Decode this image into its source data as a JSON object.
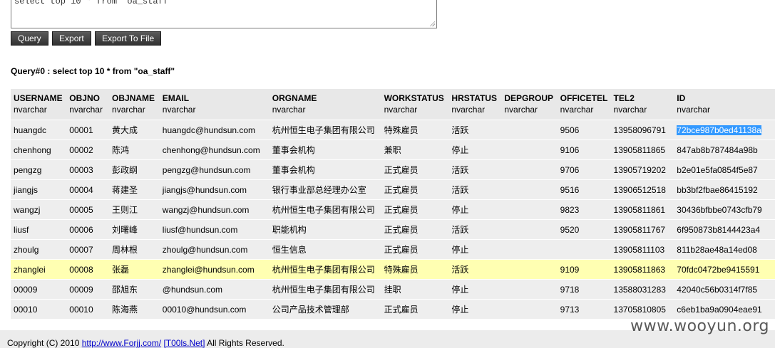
{
  "editor": {
    "sql_text": "select top 10 * from \"oa_staff\""
  },
  "toolbar": {
    "query_label": "Query",
    "export_label": "Export",
    "export_file_label": "Export To File"
  },
  "result": {
    "title": "Query#0 : select top 10 * from \"oa_staff\"",
    "columns": [
      {
        "name": "USERNAME",
        "type": "nvarchar"
      },
      {
        "name": "OBJNO",
        "type": "nvarchar"
      },
      {
        "name": "OBJNAME",
        "type": "nvarchar"
      },
      {
        "name": "EMAIL",
        "type": "nvarchar"
      },
      {
        "name": "ORGNAME",
        "type": "nvarchar"
      },
      {
        "name": "WORKSTATUS",
        "type": "nvarchar"
      },
      {
        "name": "HRSTATUS",
        "type": "nvarchar"
      },
      {
        "name": "DEPGROUP",
        "type": "nvarchar"
      },
      {
        "name": "OFFICETEL",
        "type": "nvarchar"
      },
      {
        "name": "TEL2",
        "type": "nvarchar"
      },
      {
        "name": "ID",
        "type": "nvarchar"
      }
    ],
    "rows": [
      [
        "huangdc",
        "00001",
        "黄大成",
        "huangdc@hundsun.com",
        "杭州恒生电子集团有限公司",
        "特殊雇员",
        "活跃",
        "",
        "9506",
        "13958096791",
        "72bce987b0ed41138a"
      ],
      [
        "chenhong",
        "00002",
        "陈鸿",
        "chenhong@hundsun.com",
        "董事会机构",
        "兼职",
        "停止",
        "",
        "9106",
        "13905811865",
        "847ab8b787484a98b"
      ],
      [
        "pengzg",
        "00003",
        "彭政纲",
        "pengzg@hundsun.com",
        "董事会机构",
        "正式雇员",
        "活跃",
        "",
        "9706",
        "13905719202",
        "b2e01e5fa0854f5e87"
      ],
      [
        "jiangjs",
        "00004",
        "蒋建圣",
        "jiangjs@hundsun.com",
        "银行事业部总经理办公室",
        "正式雇员",
        "活跃",
        "",
        "9516",
        "13906512518",
        "bb3bf2fbae86415192"
      ],
      [
        "wangzj",
        "00005",
        "王则江",
        "wangzj@hundsun.com",
        "杭州恒生电子集团有限公司",
        "正式雇员",
        "停止",
        "",
        "9823",
        "13905811861",
        "30436bfbbe0743cfb79"
      ],
      [
        "liusf",
        "00006",
        "刘曙峰",
        "liusf@hundsun.com",
        "职能机构",
        "正式雇员",
        "活跃",
        "",
        "9520",
        "13905811767",
        "6f950873b8144423a4"
      ],
      [
        "zhoulg",
        "00007",
        "周林根",
        "zhoulg@hundsun.com",
        "恒生信息",
        "正式雇员",
        "停止",
        "",
        "",
        "13905811103",
        "811b28ae48a14ed08"
      ],
      [
        "zhanglei",
        "00008",
        "张磊",
        "zhanglei@hundsun.com",
        "杭州恒生电子集团有限公司",
        "特殊雇员",
        "活跃",
        "",
        "9109",
        "13905811863",
        "70fdc0472be9415591"
      ],
      [
        "00009",
        "00009",
        "邵旭东",
        "@hundsun.com",
        "杭州恒生电子集团有限公司",
        "挂职",
        "停止",
        "",
        "9718",
        "13588031283",
        "42040c56b0314f7f85"
      ],
      [
        "00010",
        "00010",
        "陈海燕",
        "00010@hundsun.com",
        "公司产品技术管理部",
        "正式雇员",
        "停止",
        "",
        "9713",
        "13705810805",
        "c6eb1ba9a0904eae91"
      ]
    ],
    "highlighted_row": 7
  },
  "footer": {
    "copyright_prefix": "Copyright (C) 2010",
    "link1": "http://www.Forjj.com/",
    "link2": "[T00ls.Net]",
    "suffix": "All Rights Reserved."
  },
  "watermark": "www.wooyun.org"
}
